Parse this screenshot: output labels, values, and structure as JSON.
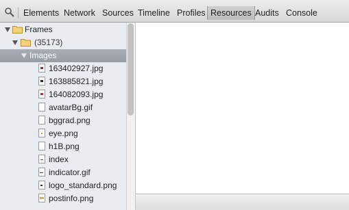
{
  "toolbar": {
    "search_icon": "search-icon",
    "tabs": [
      {
        "label": "Elements"
      },
      {
        "label": "Network"
      },
      {
        "label": "Sources"
      },
      {
        "label": "Timeline"
      },
      {
        "label": "Profiles"
      },
      {
        "label": "Resources",
        "active": true
      },
      {
        "label": "Audits"
      },
      {
        "label": "Console"
      }
    ]
  },
  "sidebar": {
    "frames_label": "Frames",
    "frame_id_label": "(35173)",
    "images_label": "Images",
    "files": [
      {
        "name": "163402927.jpg",
        "icon": "image-file-icon"
      },
      {
        "name": "163885821.jpg",
        "icon": "image-file-icon"
      },
      {
        "name": "164082093.jpg",
        "icon": "image-file-icon"
      },
      {
        "name": "avatarBg.gif",
        "icon": "blank-file-icon"
      },
      {
        "name": "bggrad.png",
        "icon": "blank-file-icon"
      },
      {
        "name": "eye.png",
        "icon": "image-file-icon"
      },
      {
        "name": "h1B.png",
        "icon": "blank-file-icon"
      },
      {
        "name": "index",
        "icon": "blank-file-icon"
      },
      {
        "name": "indicator.gif",
        "icon": "image-file-icon"
      },
      {
        "name": "logo_standard.png",
        "icon": "image-file-icon"
      },
      {
        "name": "postinfo.png",
        "icon": "image-file-icon"
      }
    ]
  },
  "colors": {
    "selected_row": "#9ea3ab",
    "sidebar_bg": "#e9edf2",
    "folder": "#e7c15a"
  }
}
